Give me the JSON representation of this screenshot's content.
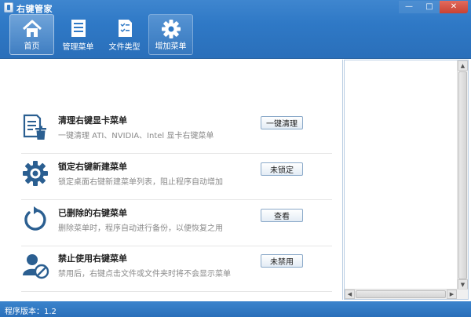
{
  "window": {
    "title": "右键管家",
    "minimize_label": "—",
    "maximize_label": "□",
    "close_label": "✕"
  },
  "toolbar": {
    "items": [
      {
        "label": "首页",
        "icon": "home-icon",
        "active": true
      },
      {
        "label": "管理菜单",
        "icon": "list-icon",
        "active": false
      },
      {
        "label": "文件类型",
        "icon": "file-type-icon",
        "active": false
      },
      {
        "label": "增加菜单",
        "icon": "gear-icon",
        "active": false
      }
    ]
  },
  "main": {
    "rows": [
      {
        "title": "清理右键显卡菜单",
        "desc": "一键清理 ATI、NVIDIA、Intel 显卡右键菜单",
        "button": "一键清理",
        "icon": "trash-list-icon"
      },
      {
        "title": "锁定右键新建菜单",
        "desc": "锁定桌面右键新建菜单列表，阻止程序自动增加",
        "button": "未锁定",
        "icon": "gear-icon"
      },
      {
        "title": "已删除的右键菜单",
        "desc": "删除菜单时，程序自动进行备份，以便恢复之用",
        "button": "查看",
        "icon": "refresh-icon"
      },
      {
        "title": "禁止使用右键菜单",
        "desc": "禁用后，右键点击文件或文件夹时将不会显示菜单",
        "button": "未禁用",
        "icon": "user-block-icon"
      }
    ]
  },
  "statusbar": {
    "version_text": "程序版本：1.2"
  },
  "colors": {
    "accent": "#2f79c6",
    "icon": "#2b5f91"
  }
}
